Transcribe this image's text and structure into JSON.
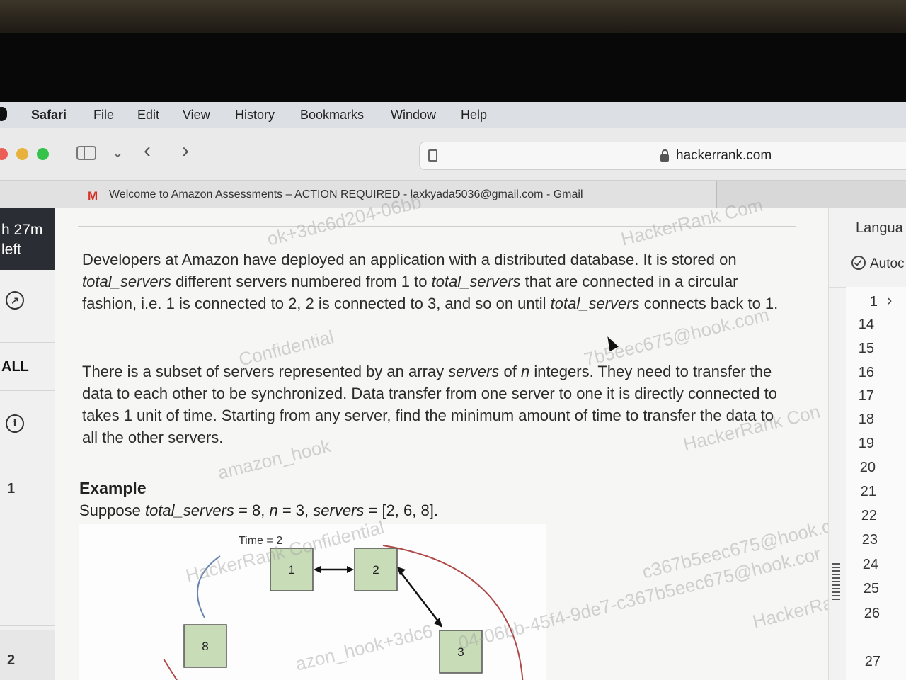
{
  "menubar": {
    "items": [
      "Safari",
      "File",
      "Edit",
      "View",
      "History",
      "Bookmarks",
      "Window",
      "Help"
    ]
  },
  "toolbar": {
    "url": "hackerrank.com",
    "traffic_colors": [
      "#ec5f57",
      "#e8b13c",
      "#34c24a"
    ]
  },
  "tab": {
    "icon": "gmail-icon",
    "title": "Welcome to Amazon Assessments – ACTION REQUIRED - laxkyada5036@gmail.com - Gmail"
  },
  "rail": {
    "timer_line1": "h 27m",
    "timer_line2": "left",
    "all_label": "ALL",
    "q1": "1",
    "q2": "2"
  },
  "question": {
    "p1": {
      "a": "Developers at Amazon have deployed an application with a distributed database. It is stored on ",
      "b": "total_servers",
      "c": " different servers numbered from 1 to ",
      "d": "total_servers",
      "e": " that are connected in a circular fashion, i.e. 1 is connected to 2, 2 is connected to 3, and so on until ",
      "f": "total_servers",
      "g": " connects back to 1."
    },
    "p2": {
      "a": "There is a subset of servers represented by an array ",
      "b": "servers",
      "c": " of ",
      "d": "n",
      "e": " integers. They need to transfer the data to each other to be synchronized. Data transfer from one server to one it is directly connected to takes 1 unit of time. Starting from any server, find the minimum amount of time to transfer the data to all the other servers."
    },
    "example_title": "Example",
    "example": {
      "a": "Suppose ",
      "b": "total_servers",
      "c": " = 8, ",
      "d": "n",
      "e": " = 3, ",
      "f": "servers",
      "g": " = [2, 6, 8]."
    },
    "diagram": {
      "time_label": "Time = 2",
      "nodes": [
        "1",
        "2",
        "3",
        "8"
      ]
    }
  },
  "watermarks": [
    "ok+3dc6d204-06bb",
    "HackerRank Com",
    "Confidential",
    "7b5eec675@hook.com",
    "amazon_hook",
    "HackerRank Con",
    "c367b5eec675@hook.com",
    "04-06bb-45f4-9de7-c367b5eec675@hook.cor",
    "azon_hook+3dc6",
    "HackerRa",
    "HackerRank Confidential"
  ],
  "editor": {
    "language_label": "Langua",
    "autocomplete_label": "Autoc",
    "line_numbers": [
      "1",
      "14",
      "15",
      "16",
      "17",
      "18",
      "19",
      "20",
      "21",
      "22",
      "23",
      "24",
      "25",
      "26",
      "27"
    ]
  }
}
